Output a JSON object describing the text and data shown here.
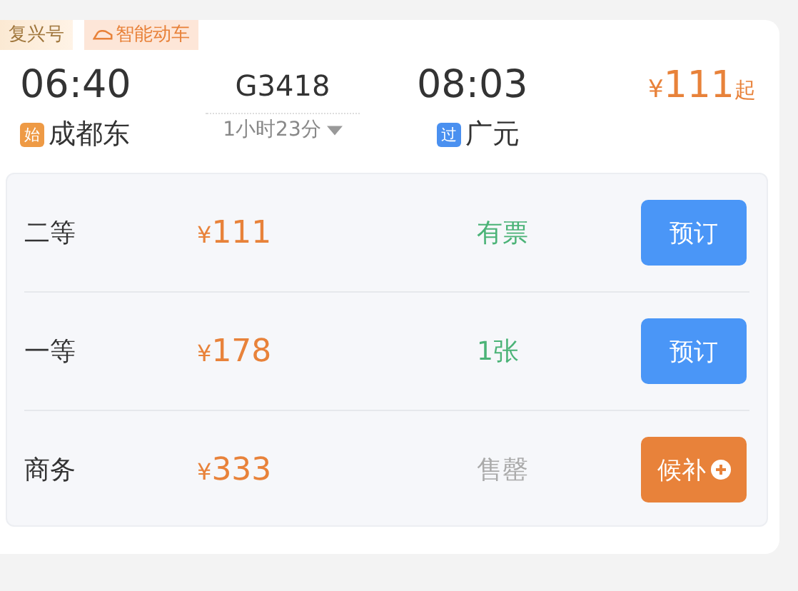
{
  "train": {
    "tags": [
      {
        "text": "复兴号",
        "kind": "plain"
      },
      {
        "text": "智能动车",
        "kind": "smart"
      }
    ],
    "depart": {
      "time": "06:40",
      "badge": "始",
      "station": "成都东"
    },
    "number": "G3418",
    "duration": "1小时23分",
    "arrive": {
      "time": "08:03",
      "badge": "过",
      "station": "广元"
    },
    "price": {
      "currency": "¥",
      "amount": "111",
      "suffix": "起"
    },
    "seats": [
      {
        "class": "二等",
        "currency": "¥",
        "price": "111",
        "status": "有票",
        "sold_out": false,
        "button": {
          "kind": "book",
          "label": "预订"
        }
      },
      {
        "class": "一等",
        "currency": "¥",
        "price": "178",
        "status": "1张",
        "sold_out": false,
        "button": {
          "kind": "book",
          "label": "预订"
        }
      },
      {
        "class": "商务",
        "currency": "¥",
        "price": "333",
        "status": "售罄",
        "sold_out": true,
        "button": {
          "kind": "waitlist",
          "label": "候补"
        }
      }
    ]
  }
}
